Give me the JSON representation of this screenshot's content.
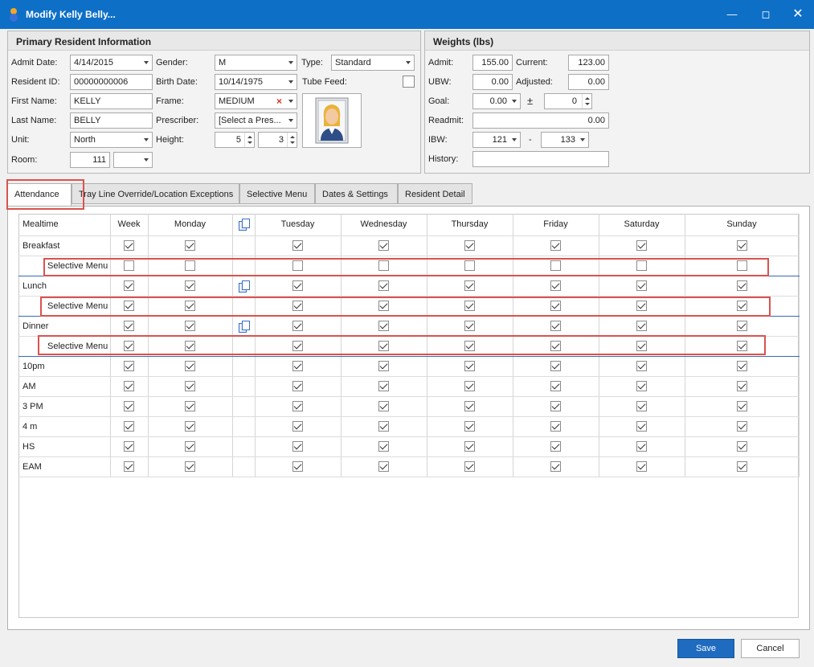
{
  "window": {
    "title": "Modify Kelly Belly..."
  },
  "primary": {
    "header": "Primary Resident Information",
    "admit_date": {
      "label": "Admit Date:",
      "value": "4/14/2015"
    },
    "resident_id": {
      "label": "Resident ID:",
      "value": "00000000006"
    },
    "first_name": {
      "label": "First Name:",
      "value": "KELLY"
    },
    "last_name": {
      "label": "Last Name:",
      "value": "BELLY"
    },
    "unit": {
      "label": "Unit:",
      "value": "North"
    },
    "room": {
      "label": "Room:",
      "value": "111",
      "bed": ""
    },
    "gender": {
      "label": "Gender:",
      "value": "M"
    },
    "birth_date": {
      "label": "Birth Date:",
      "value": "10/14/1975"
    },
    "frame": {
      "label": "Frame:",
      "value": "MEDIUM"
    },
    "prescriber": {
      "label": "Prescriber:",
      "value": "[Select a Pres..."
    },
    "height": {
      "label": "Height:",
      "feet": "5",
      "inches": "3"
    },
    "type": {
      "label": "Type:",
      "value": "Standard"
    },
    "tube_feed": {
      "label": "Tube Feed:",
      "checked": false
    }
  },
  "weights": {
    "header": "Weights (lbs)",
    "admit": {
      "label": "Admit:",
      "value": "155.00"
    },
    "current": {
      "label": "Current:",
      "value": "123.00"
    },
    "ubw": {
      "label": "UBW:",
      "value": "0.00"
    },
    "adjusted": {
      "label": "Adjusted:",
      "value": "0.00"
    },
    "goal": {
      "label": "Goal:",
      "value": "0.00",
      "pm_symbol": "±",
      "pm_value": "0"
    },
    "readmit": {
      "label": "Readmit:",
      "value": "0.00"
    },
    "ibw": {
      "label": "IBW:",
      "low": "121",
      "dash": "-",
      "high": "133"
    },
    "history": {
      "label": "History:",
      "value": ""
    }
  },
  "tabs": [
    {
      "label": "Attendance",
      "active": true
    },
    {
      "label": "Tray Line Override/Location Exceptions"
    },
    {
      "label": "Selective Menu"
    },
    {
      "label": "Dates & Settings"
    },
    {
      "label": "Resident Detail"
    }
  ],
  "grid": {
    "headers": {
      "mealtime": "Mealtime",
      "week": "Week",
      "monday": "Monday",
      "tuesday": "Tuesday",
      "wednesday": "Wednesday",
      "thursday": "Thursday",
      "friday": "Friday",
      "saturday": "Saturday",
      "sunday": "Sunday"
    },
    "rows": [
      {
        "name": "Breakfast",
        "sub": false,
        "copy": false,
        "checks": [
          true,
          true,
          true,
          true,
          true,
          true,
          true,
          true
        ]
      },
      {
        "name": "Selective Menu",
        "sub": true,
        "copy": false,
        "checks": [
          false,
          false,
          false,
          false,
          false,
          false,
          false,
          false
        ]
      },
      {
        "name": "Lunch",
        "sub": false,
        "copy": true,
        "checks": [
          true,
          true,
          true,
          true,
          true,
          true,
          true,
          true
        ]
      },
      {
        "name": "Selective Menu",
        "sub": true,
        "copy": false,
        "checks": [
          true,
          true,
          true,
          true,
          true,
          true,
          true,
          true
        ]
      },
      {
        "name": "Dinner",
        "sub": false,
        "copy": true,
        "checks": [
          true,
          true,
          true,
          true,
          true,
          true,
          true,
          true
        ]
      },
      {
        "name": "Selective Menu",
        "sub": true,
        "copy": false,
        "checks": [
          true,
          true,
          true,
          true,
          true,
          true,
          true,
          true
        ]
      },
      {
        "name": "10pm",
        "sub": false,
        "copy": false,
        "checks": [
          true,
          true,
          true,
          true,
          true,
          true,
          true,
          true
        ]
      },
      {
        "name": "AM",
        "sub": false,
        "copy": false,
        "checks": [
          true,
          true,
          true,
          true,
          true,
          true,
          true,
          true
        ]
      },
      {
        "name": "3 PM",
        "sub": false,
        "copy": false,
        "checks": [
          true,
          true,
          true,
          true,
          true,
          true,
          true,
          true
        ]
      },
      {
        "name": "4 m",
        "sub": false,
        "copy": false,
        "checks": [
          true,
          true,
          true,
          true,
          true,
          true,
          true,
          true
        ]
      },
      {
        "name": "HS",
        "sub": false,
        "copy": false,
        "checks": [
          true,
          true,
          true,
          true,
          true,
          true,
          true,
          true
        ]
      },
      {
        "name": "EAM",
        "sub": false,
        "copy": false,
        "checks": [
          true,
          true,
          true,
          true,
          true,
          true,
          true,
          true
        ]
      }
    ]
  },
  "buttons": {
    "save": "Save",
    "cancel": "Cancel"
  },
  "colors": {
    "titlebar": "#0e6fc7",
    "save_button": "#1e6bc0",
    "highlight": "#d9534f",
    "row_separator": "#3a67b8"
  }
}
